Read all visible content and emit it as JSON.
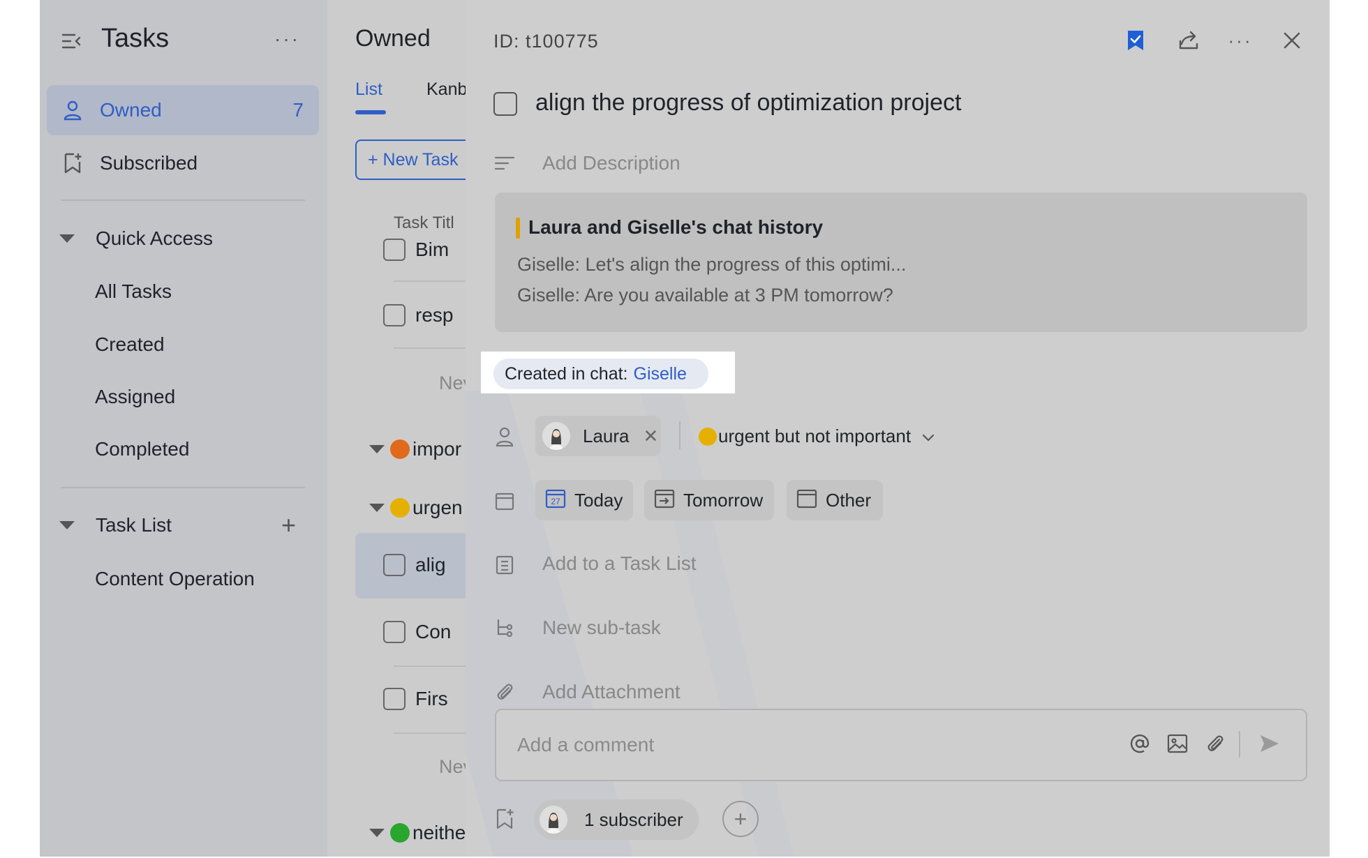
{
  "sidebar": {
    "title": "Tasks",
    "more": "···",
    "items": [
      {
        "label": "Owned",
        "count": "7"
      },
      {
        "label": "Subscribed"
      }
    ],
    "quick_access": {
      "label": "Quick Access",
      "items": [
        "All Tasks",
        "Created",
        "Assigned",
        "Completed"
      ]
    },
    "task_list": {
      "label": "Task List",
      "add": "+",
      "items": [
        "Content Operation"
      ]
    }
  },
  "middle": {
    "title": "Owned",
    "tabs": [
      "List",
      "Kanb"
    ],
    "new_task": "+ New Task",
    "column_header": "Task Titl",
    "rows_a": [
      "Bim",
      "resp"
    ],
    "new_row": "Nev",
    "groups": [
      {
        "label": "impor",
        "color": "#e06a1a"
      },
      {
        "label": "urgen",
        "color": "#e5b000"
      },
      {
        "label": "neithe",
        "color": "#2aa52e"
      }
    ],
    "rows_b": [
      "alig",
      "Con",
      "Firs"
    ],
    "new_row_b": "Nev"
  },
  "detail": {
    "id_label": "ID:",
    "id_value": "t100775",
    "title": "align the progress of optimization project",
    "add_description": "Add Description",
    "chat": {
      "title": "Laura and Giselle's chat history",
      "lines": [
        "Giselle: Let's align the progress of this optimi...",
        "Giselle: Are you available at 3 PM tomorrow?"
      ]
    },
    "origin": {
      "prefix": "Created in chat:",
      "link": "Giselle"
    },
    "assignee": {
      "name": "Laura",
      "remove": "✕"
    },
    "priority": {
      "label": "urgent but not important",
      "color": "#e5b000"
    },
    "due": {
      "today": "Today",
      "today_num": "27",
      "tomorrow": "Tomorrow",
      "other": "Other"
    },
    "add_task_list": "Add to a Task List",
    "new_subtask": "New sub-task",
    "add_attachment": "Add Attachment",
    "comment_placeholder": "Add a comment",
    "subscribers": "1 subscriber",
    "add_subscriber": "+"
  },
  "colors": {
    "accent": "#2f5ec4",
    "bookmark": "#1f5fd6"
  }
}
